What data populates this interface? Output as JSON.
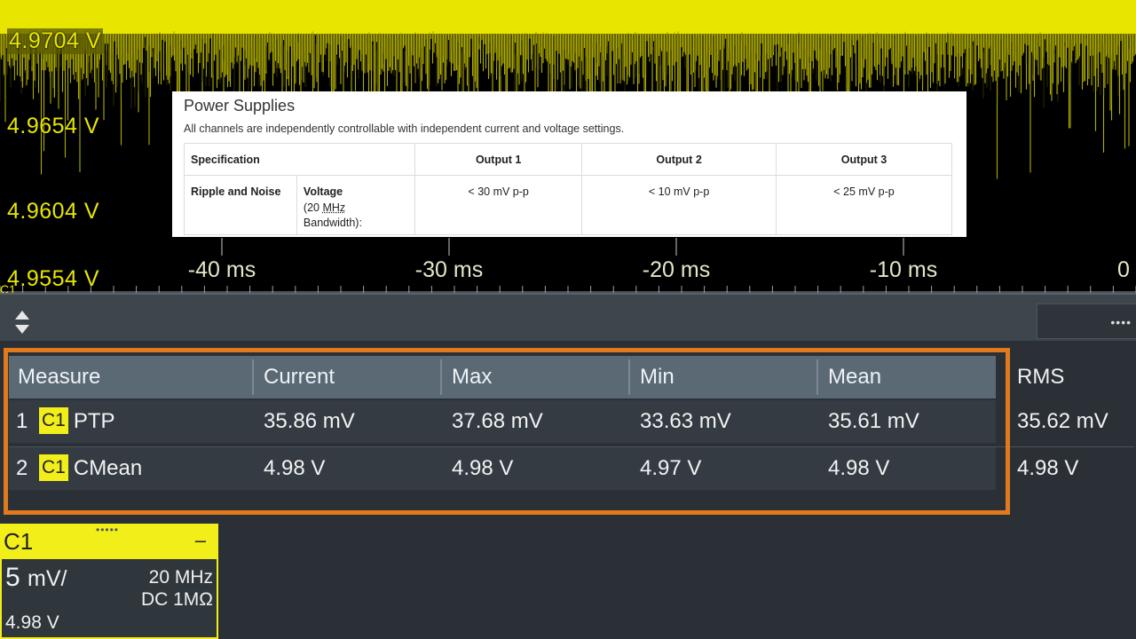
{
  "scope": {
    "y_labels": [
      "4.9704 V",
      "4.9654 V",
      "4.9604 V",
      "4.9554 V"
    ],
    "time_labels": [
      "-40 ms",
      "-30 ms",
      "-20 ms",
      "-10 ms",
      "0"
    ],
    "channel_marker": "C1",
    "colors": {
      "trace": "#e8e600",
      "background": "#000000"
    }
  },
  "spec_card": {
    "title": "Power Supplies",
    "description": "All channels are independently controllable with independent current and voltage settings.",
    "headers": {
      "specification": "Specification",
      "output1": "Output 1",
      "output2": "Output 2",
      "output3": "Output 3"
    },
    "row": {
      "name": "Ripple and Noise",
      "param_bold": "Voltage",
      "param_open": "(20 ",
      "param_mhz": "MHz",
      "param_bw": "Bandwidth):",
      "output1": "< 30 mV p-p",
      "output2": "< 10 mV p-p",
      "output3": "< 25 mV p-p"
    }
  },
  "results": {
    "headers": [
      "Measure",
      "Current",
      "Max",
      "Min",
      "Mean",
      "RMS"
    ],
    "rows": [
      {
        "index": "1",
        "channel": "C1",
        "name": "PTP",
        "current": "35.86 mV",
        "max": "37.68 mV",
        "min": "33.63 mV",
        "mean": "35.61 mV",
        "rms": "35.62 mV"
      },
      {
        "index": "2",
        "channel": "C1",
        "name": "CMean",
        "current": "4.98 V",
        "max": "4.98 V",
        "min": "4.97 V",
        "mean": "4.98 V",
        "rms": "4.98 V"
      }
    ],
    "highlight_color": "#e07a1d"
  },
  "channel_badge": {
    "name": "C1",
    "minimize": "–",
    "scale_value": "5",
    "scale_unit": "mV/",
    "bandwidth": "20 MHz",
    "coupling": "DC 1MΩ",
    "offset": "4.98 V",
    "color": "#f2ee1a"
  }
}
